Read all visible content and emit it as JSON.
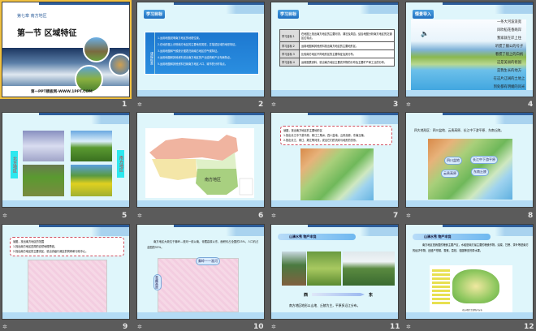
{
  "slides": [
    {
      "number": "1",
      "chapter": "第七章  南方地区",
      "title": "第一节 区域特征",
      "footer": "第一PPT模板网-WWW.1PPT.COM"
    },
    {
      "number": "2",
      "tag": "学习目标",
      "side_label": "课程标准",
      "lines": [
        "1.运用地图说明南方地区的地理位置。",
        "2.在地形图上识别南方地区的主要地形类型，并描述区域的地形特征。",
        "3.运用地图和气候统计图表归纳南方地区的气候特征。",
        "4.运用地图和其他资料说出南方地区的产业结构和产业布局特点。",
        "5.运用地图和其他资料归纳南方地区人口、城市的分布特点。"
      ]
    },
    {
      "number": "3",
      "tag": "学习目标",
      "rows": [
        {
          "k": "学习目标 1",
          "v": "在地图上找出南方地区的主要河流、湖泊及周边，结合地图分析南方地区的交通区位特点。"
        },
        {
          "k": "学习目标 2",
          "v": "运用地图和其他资料找出南方地区的主要地形区。"
        },
        {
          "k": "学习目标 3",
          "v": "比较南方地区不同地形区的主要特征及其分布。"
        },
        {
          "k": "学习目标 4",
          "v": "运用图表资料，说出南方地区主要农作物的分布及主要矿产和工业的分布。"
        }
      ]
    },
    {
      "number": "4",
      "tag": "情景导入",
      "poem": [
        "一条大河波浪宽",
        "风吹稻花香两岸",
        "我家就在岸上住",
        "听惯了艄公的号子",
        "看惯了船上的白帆",
        "这是美丽的祖国",
        "是我生长的地方",
        "在这片辽阔的土地上",
        "到处都有明媚的风光"
      ]
    },
    {
      "number": "5",
      "left_label": "北方地区",
      "right_label": "南方地区"
    },
    {
      "number": "6",
      "map_label": "南方地区"
    },
    {
      "number": "7",
      "box": [
        "读图，找出南方地区的主要地形区",
        "1.找出长江中下游平原、珠江三角洲、四川盆地、云贵高原、东南丘陵。",
        "2.找出长江、珠江、湘江等河流，说出它们的流向与地形的关系。"
      ]
    },
    {
      "number": "8",
      "heading": "四大地形区：四川盆地、云贵高原、长江中下游平原、东南丘陵。",
      "labels": [
        "四川盆地",
        "长江中下游平原",
        "云贵高原",
        "东南丘陵"
      ]
    },
    {
      "number": "9",
      "box": [
        "读图，找出南方地区的范围",
        "1.找出南方地区四周的自然地理界线。",
        "2.找出南方地区的主要省区，说出省级行政区的简称和行政中心。"
      ]
    },
    {
      "number": "10",
      "text": "南方地区大致位于秦岭—淮河一线以南，青藏高原以东，面积约占全国的25%，人口约占全国的55%。",
      "labels": [
        "秦岭——淮河",
        "青藏高原"
      ],
      "link": "返回到目录"
    },
    {
      "number": "11",
      "tag": "山清水秀 物产丰饶",
      "west": "西",
      "east": "东",
      "caption": "南方地区地形以山地、丘陵为主，平原多沿江分布。"
    },
    {
      "number": "12",
      "tag": "山清水秀 物产丰饶",
      "text": "南方地区是我国的粮食主要产区，水稻是南方最主要的粮食作物。油菜、甘蔗、茶叶等是南方的经济作物，还盛产柑橘、香蕉、荔枝、桂圆等亚热带水果。",
      "map_caption": "南方地区主要物产分布"
    }
  ]
}
